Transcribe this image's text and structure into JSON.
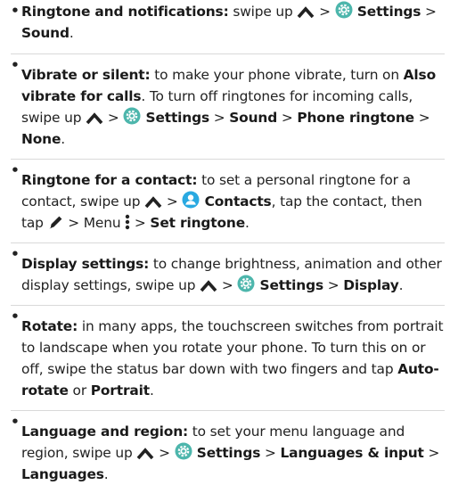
{
  "colors": {
    "text": "#222222",
    "divider": "#d9d9d9",
    "settings_icon": "#4db6ac",
    "contacts_icon": "#29a9e1"
  },
  "items": [
    {
      "title": "Ringtone and notifications:",
      "t1": " swipe up ",
      "t2": " > ",
      "settings": "Settings",
      "t3": " > ",
      "sound": "Sound",
      "t4": ".",
      "icons": [
        "chevron-up-icon",
        "settings-icon"
      ]
    },
    {
      "title": "Vibrate or silent:",
      "t1": " to make your phone vibrate, turn on ",
      "also_vibrate": "Also vibrate for calls",
      "t2": ". To turn off ringtones for incoming calls, swipe up ",
      "t3": " > ",
      "settings": "Settings",
      "t4": " > ",
      "sound": "Sound",
      "t5": " > ",
      "phone_ringtone": "Phone ringtone",
      "t6": " > ",
      "none": "None",
      "t7": ".",
      "icons": [
        "chevron-up-icon",
        "settings-icon"
      ]
    },
    {
      "title": "Ringtone for a contact:",
      "t1": " to set a personal ringtone for a contact, swipe up ",
      "t2": " > ",
      "contacts": "Contacts",
      "t3": ", tap the contact, then tap ",
      "t4": " > Menu ",
      "t5": " > ",
      "set_ringtone": "Set ringtone",
      "t6": ".",
      "icons": [
        "chevron-up-icon",
        "contacts-icon",
        "edit-pencil-icon",
        "menu-dots-icon"
      ]
    },
    {
      "title": "Display settings:",
      "t1": " to change brightness, animation and other display settings, swipe up ",
      "t2": " > ",
      "settings": "Settings",
      "t3": " > ",
      "display": "Display",
      "t4": ".",
      "icons": [
        "chevron-up-icon",
        "settings-icon"
      ]
    },
    {
      "title": "Rotate:",
      "t1": " in many apps, the touchscreen switches from portrait to landscape when you rotate your phone. To turn this on or off, swipe the status bar down with two fingers and tap ",
      "auto_rotate": "Auto-rotate",
      "t2": " or ",
      "portrait": "Portrait",
      "t3": "."
    },
    {
      "title": "Language and region:",
      "t1": " to set your menu language and region, swipe up ",
      "t2": " > ",
      "settings": "Settings",
      "t3": " > ",
      "languages_input": "Languages & input",
      "t4": " > ",
      "languages": "Languages",
      "t5": ".",
      "icons": [
        "chevron-up-icon",
        "settings-icon"
      ]
    }
  ]
}
